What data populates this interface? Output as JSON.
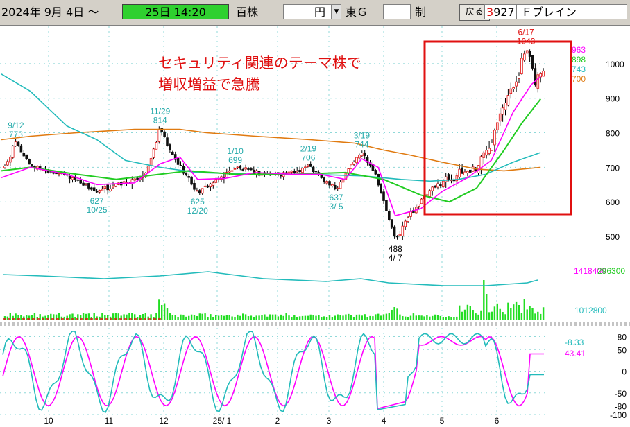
{
  "toolbar": {
    "date_start": "2024年 9月 4日 ～",
    "date_end": "25日 14:20",
    "unit_label": "百株",
    "currency_label": "円",
    "market_label": "東Ｇ",
    "restriction_label": "制",
    "back_button": "戻る",
    "code_prefix": "3",
    "code_rest": "927",
    "company_name": "Ｆブレイン"
  },
  "annotation": {
    "line1": "セキュリティ関連のテーマ株で",
    "line2": "増収増益で急騰"
  },
  "colors": {
    "grid": "#8fd8d8",
    "ma_short": "#ff00ff",
    "ma_mid": "#22cc22",
    "ma_long": "#22bbbb",
    "ma_longest": "#e07a10",
    "volume": "#22dd22",
    "volume_ma": "#22bbbb",
    "stoch_k": "#22bbbb",
    "stoch_d": "#ff00ff",
    "highlight_box": "#e01010",
    "annotation_text": "#e01010"
  },
  "chart_data": {
    "type": "candlestick",
    "price_axis": {
      "ticks": [
        "1000",
        "900",
        "800",
        "700",
        "600",
        "500"
      ],
      "range": [
        460,
        1080
      ]
    },
    "x_axis_labels": [
      "10",
      "11",
      "12",
      "25/ 1",
      "2",
      "3",
      "4",
      "5",
      "6"
    ],
    "ma_readout": [
      {
        "value": "963",
        "color": "#ff00ff"
      },
      {
        "value": "898",
        "color": "#22cc22"
      },
      {
        "value": "743",
        "color": "#22bbbb"
      },
      {
        "value": "700",
        "color": "#e07a10"
      }
    ],
    "price_callouts": [
      {
        "label": "9/12",
        "value": "773",
        "x_date": "9/12",
        "price": 773,
        "pos": "above",
        "color": "#22aaaa"
      },
      {
        "label": "627",
        "value": "10/25",
        "x_date": "10/25",
        "price": 627,
        "pos": "below",
        "color": "#22aaaa"
      },
      {
        "label": "11/29",
        "value": "814",
        "x_date": "11/29",
        "price": 814,
        "pos": "above",
        "color": "#22aaaa"
      },
      {
        "label": "625",
        "value": "12/20",
        "x_date": "12/20",
        "price": 625,
        "pos": "below",
        "color": "#22aaaa"
      },
      {
        "label": "1/10",
        "value": "699",
        "x_date": "1/10",
        "price": 699,
        "pos": "above",
        "color": "#22aaaa"
      },
      {
        "label": "2/19",
        "value": "706",
        "x_date": "2/19",
        "price": 706,
        "pos": "above",
        "color": "#22aaaa"
      },
      {
        "label": "637",
        "value": "3/ 5",
        "x_date": "3/5",
        "price": 637,
        "pos": "below",
        "color": "#22aaaa"
      },
      {
        "label": "3/19",
        "value": "744",
        "x_date": "3/19",
        "price": 744,
        "pos": "above",
        "color": "#22aaaa"
      },
      {
        "label": "488",
        "value": "4/ 7",
        "x_date": "4/7",
        "price": 488,
        "pos": "below",
        "color": "#000000"
      },
      {
        "label": "6/17",
        "value": "1043",
        "x_date": "6/17",
        "price": 1043,
        "pos": "above",
        "color": "#e01010"
      }
    ],
    "price_path": [
      [
        "9/4",
        680
      ],
      [
        "9/12",
        773
      ],
      [
        "9/20",
        705
      ],
      [
        "9/30",
        690
      ],
      [
        "10/8",
        680
      ],
      [
        "10/15",
        665
      ],
      [
        "10/25",
        627
      ],
      [
        "11/5",
        650
      ],
      [
        "11/15",
        660
      ],
      [
        "11/22",
        690
      ],
      [
        "11/29",
        814
      ],
      [
        "12/5",
        740
      ],
      [
        "12/12",
        690
      ],
      [
        "12/20",
        625
      ],
      [
        "12/27",
        650
      ],
      [
        "1/10",
        699
      ],
      [
        "1/20",
        685
      ],
      [
        "1/30",
        680
      ],
      [
        "2/10",
        685
      ],
      [
        "2/19",
        706
      ],
      [
        "2/26",
        670
      ],
      [
        "3/5",
        637
      ],
      [
        "3/12",
        700
      ],
      [
        "3/19",
        744
      ],
      [
        "3/26",
        690
      ],
      [
        "4/1",
        600
      ],
      [
        "4/7",
        488
      ],
      [
        "4/14",
        560
      ],
      [
        "4/21",
        610
      ],
      [
        "5/1",
        660
      ],
      [
        "5/10",
        680
      ],
      [
        "5/20",
        700
      ],
      [
        "5/28",
        780
      ],
      [
        "6/3",
        870
      ],
      [
        "6/10",
        930
      ],
      [
        "6/17",
        1043
      ],
      [
        "6/22",
        950
      ],
      [
        "6/25",
        975
      ]
    ],
    "moving_averages": {
      "short": [
        [
          "9/4",
          670
        ],
        [
          "9/20",
          700
        ],
        [
          "10/10",
          680
        ],
        [
          "10/25",
          650
        ],
        [
          "11/15",
          655
        ],
        [
          "11/29",
          710
        ],
        [
          "12/10",
          730
        ],
        [
          "12/20",
          665
        ],
        [
          "1/5",
          668
        ],
        [
          "1/20",
          685
        ],
        [
          "2/10",
          680
        ],
        [
          "2/26",
          680
        ],
        [
          "3/10",
          665
        ],
        [
          "3/19",
          725
        ],
        [
          "3/28",
          700
        ],
        [
          "4/7",
          560
        ],
        [
          "4/20",
          580
        ],
        [
          "5/1",
          630
        ],
        [
          "5/15",
          670
        ],
        [
          "5/28",
          720
        ],
        [
          "6/10",
          860
        ],
        [
          "6/20",
          940
        ],
        [
          "6/25",
          963
        ]
      ],
      "mid": [
        [
          "9/4",
          690
        ],
        [
          "9/20",
          700
        ],
        [
          "10/15",
          680
        ],
        [
          "11/5",
          665
        ],
        [
          "11/29",
          680
        ],
        [
          "12/15",
          690
        ],
        [
          "1/10",
          680
        ],
        [
          "2/10",
          680
        ],
        [
          "3/10",
          685
        ],
        [
          "4/1",
          665
        ],
        [
          "4/20",
          620
        ],
        [
          "5/5",
          600
        ],
        [
          "5/20",
          640
        ],
        [
          "6/5",
          750
        ],
        [
          "6/15",
          830
        ],
        [
          "6/25",
          898
        ]
      ],
      "long": [
        [
          "9/4",
          970
        ],
        [
          "9/20",
          920
        ],
        [
          "10/10",
          820
        ],
        [
          "10/25",
          780
        ],
        [
          "11/10",
          720
        ],
        [
          "11/29",
          700
        ],
        [
          "12/20",
          685
        ],
        [
          "1/20",
          680
        ],
        [
          "2/20",
          680
        ],
        [
          "3/20",
          675
        ],
        [
          "4/10",
          665
        ],
        [
          "4/25",
          660
        ],
        [
          "5/10",
          665
        ],
        [
          "5/25",
          680
        ],
        [
          "6/10",
          715
        ],
        [
          "6/25",
          743
        ]
      ],
      "longest": [
        [
          "9/4",
          780
        ],
        [
          "9/20",
          790
        ],
        [
          "10/15",
          800
        ],
        [
          "11/15",
          810
        ],
        [
          "12/10",
          810
        ],
        [
          "12/25",
          800
        ],
        [
          "1/20",
          790
        ],
        [
          "2/20",
          780
        ],
        [
          "3/15",
          770
        ],
        [
          "4/1",
          750
        ],
        [
          "4/15",
          735
        ],
        [
          "5/1",
          715
        ],
        [
          "5/20",
          695
        ],
        [
          "6/5",
          690
        ],
        [
          "6/25",
          700
        ]
      ]
    },
    "volume": {
      "readout_left": "1418400",
      "readout_right": "296300",
      "readout_ma": "1012800"
    },
    "oscillator": {
      "ticks": [
        "80",
        "50",
        "0",
        "-50",
        "-80",
        "-100"
      ],
      "range": [
        -100,
        100
      ],
      "readout_k": "-8.33",
      "readout_d": "43.41"
    }
  }
}
